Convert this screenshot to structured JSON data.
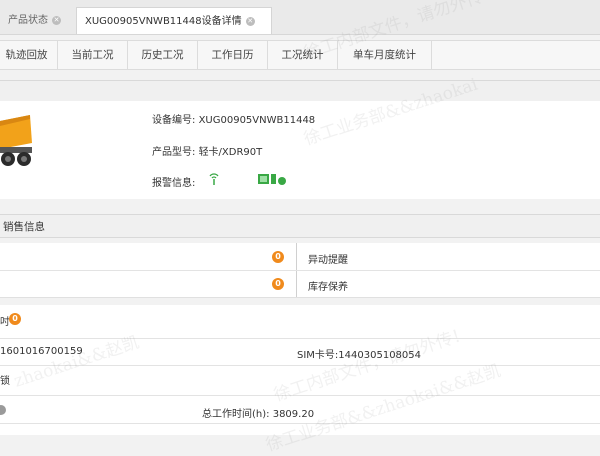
{
  "tabs": [
    {
      "label": "产品状态",
      "active": false
    },
    {
      "label": "XUG00905VNWB11448设备详情",
      "active": true
    }
  ],
  "subnav": [
    "轨迹回放",
    "当前工况",
    "历史工况",
    "工作日历",
    "工况统计",
    "单车月度统计"
  ],
  "device": {
    "id_label": "设备编号:",
    "id_value": "XUG00905VNWB11448",
    "model_label": "产品型号:",
    "model_value": "轻卡/XDR90T",
    "alarm_label": "报警信息:"
  },
  "sales_section": {
    "title": "销售信息"
  },
  "list_rows": [
    {
      "badge": "0",
      "label": "异动提醒"
    },
    {
      "badge": "0",
      "label": "库存保养"
    }
  ],
  "info": {
    "badge": "0",
    "partial_number": "1601016700159",
    "sim_label": "SIM卡号:",
    "sim_value": "1440305108054",
    "lock_text": "锁",
    "work_time_label": "总工作时间(h):",
    "work_time_value": "3809.20"
  },
  "watermarks": [
    "徐工内部文件，请勿外传！",
    "徐工业务部&&zhaokai",
    "徐工内部文件，请勿外传！",
    "徐工业务部&&zhaokai&&赵凯",
    "zhaokai&&赵凯"
  ],
  "colors": {
    "accent": "#f08a1c",
    "green": "#39a845"
  }
}
